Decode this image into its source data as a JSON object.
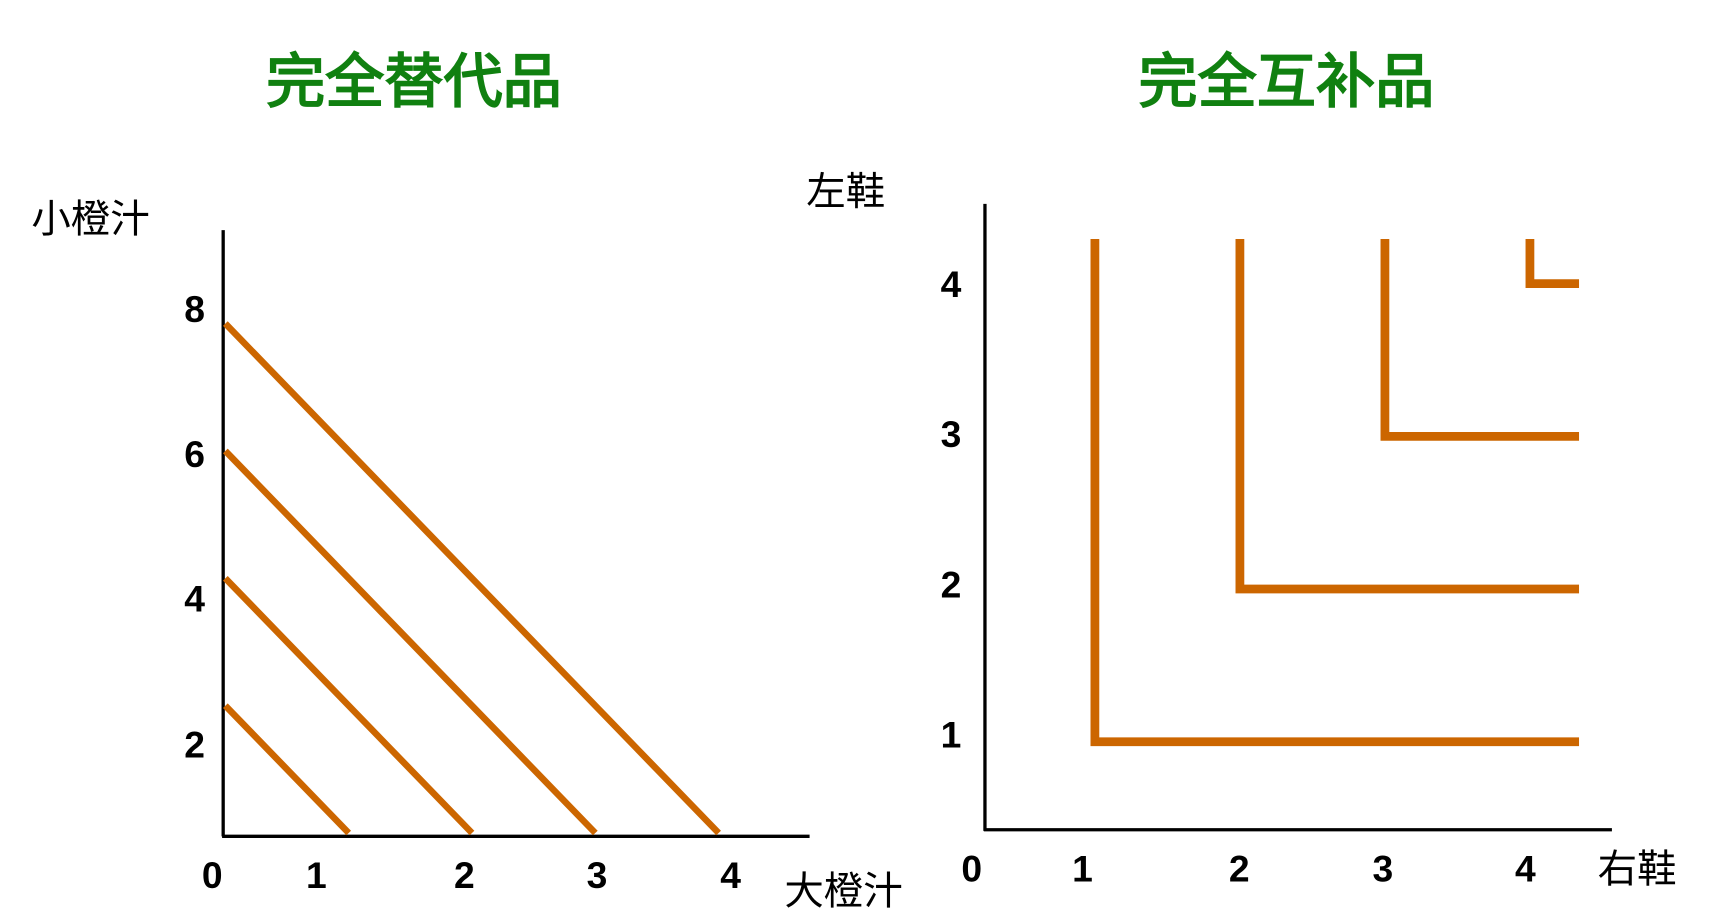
{
  "colors": {
    "title": "#108010",
    "curve": "#CC6600",
    "axis": "#000000"
  },
  "chart_data": [
    {
      "type": "line",
      "title": "完全替代品",
      "xlabel": "大橙汁",
      "ylabel": "小橙汁",
      "x_ticks": [
        "0",
        "1",
        "2",
        "3",
        "4"
      ],
      "y_ticks": [
        "8",
        "6",
        "4",
        "2"
      ],
      "grid": false,
      "series": [
        {
          "points": [
            [
              0,
              8
            ],
            [
              4,
              0
            ]
          ]
        },
        {
          "points": [
            [
              0,
              6
            ],
            [
              3,
              0
            ]
          ]
        },
        {
          "points": [
            [
              0,
              4
            ],
            [
              2,
              0
            ]
          ]
        },
        {
          "points": [
            [
              0,
              2
            ],
            [
              1,
              0
            ]
          ]
        }
      ]
    },
    {
      "type": "line",
      "title": "完全互补品",
      "xlabel": "右鞋",
      "ylabel": "左鞋",
      "x_ticks": [
        "0",
        "1",
        "2",
        "3",
        "4"
      ],
      "y_ticks": [
        "4",
        "3",
        "2",
        "1"
      ],
      "grid": false,
      "series": [
        {
          "corner": [
            1,
            1
          ]
        },
        {
          "corner": [
            2,
            2
          ]
        },
        {
          "corner": [
            3,
            3
          ]
        },
        {
          "corner": [
            4,
            4
          ]
        }
      ]
    }
  ]
}
